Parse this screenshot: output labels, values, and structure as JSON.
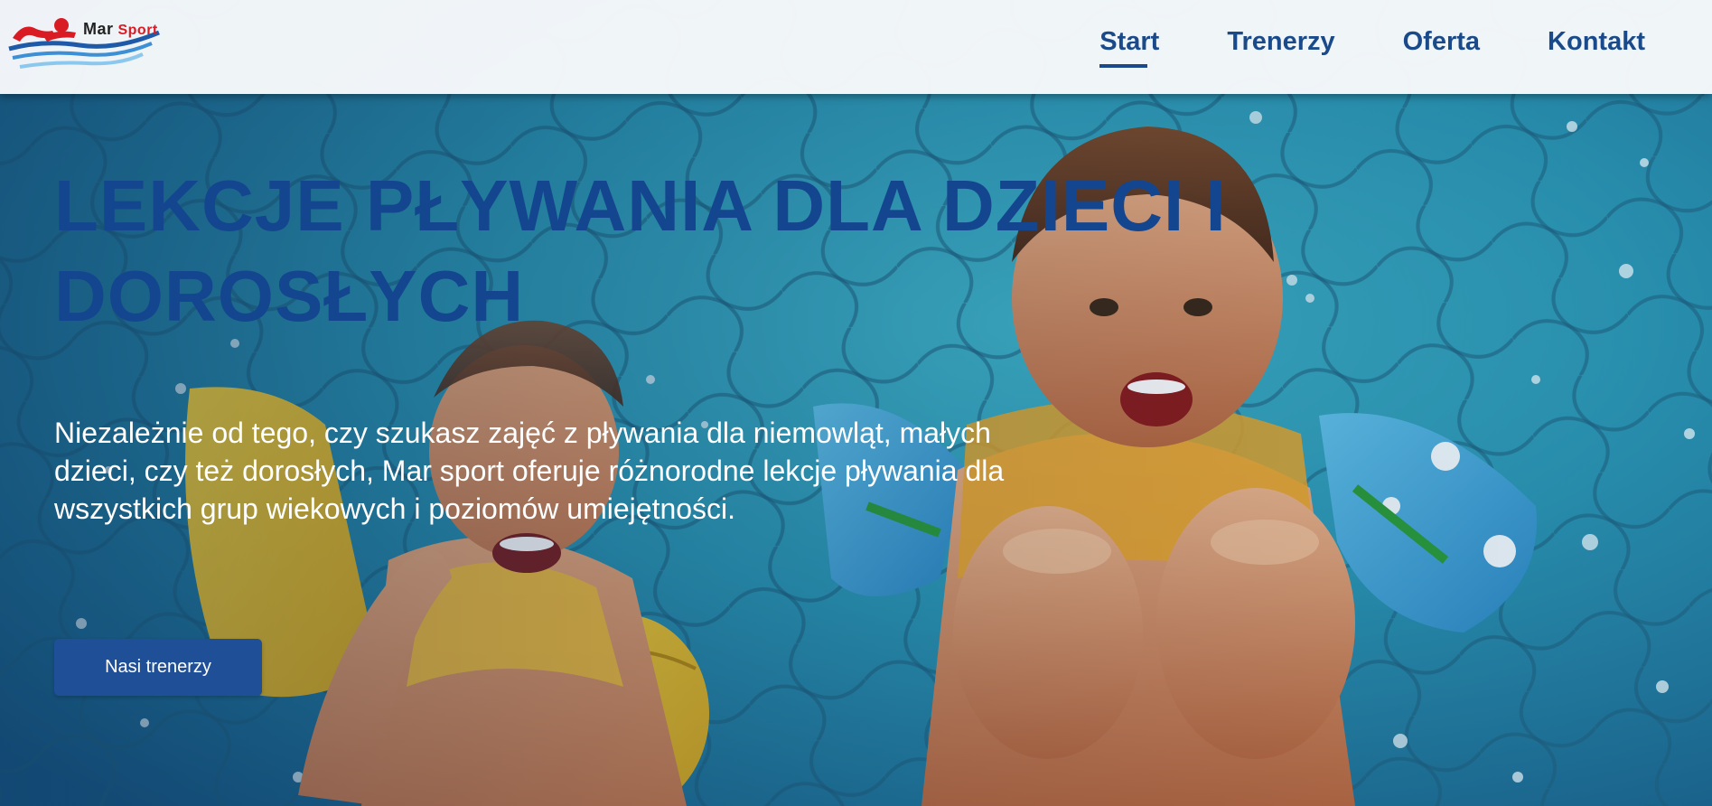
{
  "logo": {
    "text_part1": "Mar",
    "text_part2": "Sport"
  },
  "nav": {
    "items": [
      {
        "label": "Start",
        "active": true
      },
      {
        "label": "Trenerzy",
        "active": false
      },
      {
        "label": "Oferta",
        "active": false
      },
      {
        "label": "Kontakt",
        "active": false
      }
    ]
  },
  "hero": {
    "title": "LEKCJE PŁYWANIA DLA DZIECI I DOROSŁYCH",
    "description": "Niezależnie od tego, czy szukasz zajęć z pływania dla niemowląt, małych dzieci, czy też dorosłych, Mar sport oferuje różnorodne lekcje pływania dla wszystkich grup wiekowych i poziomów umiejętności.",
    "cta_label": "Nasi trenerzy"
  },
  "colors": {
    "brand_blue": "#1a4a8a",
    "title_blue": "#14468f",
    "button_blue": "#1f4f96",
    "logo_red": "#d91c24",
    "header_bg": "#f7f9fb"
  },
  "icons": {
    "logo_mark": "swimmer-waves-logo"
  }
}
